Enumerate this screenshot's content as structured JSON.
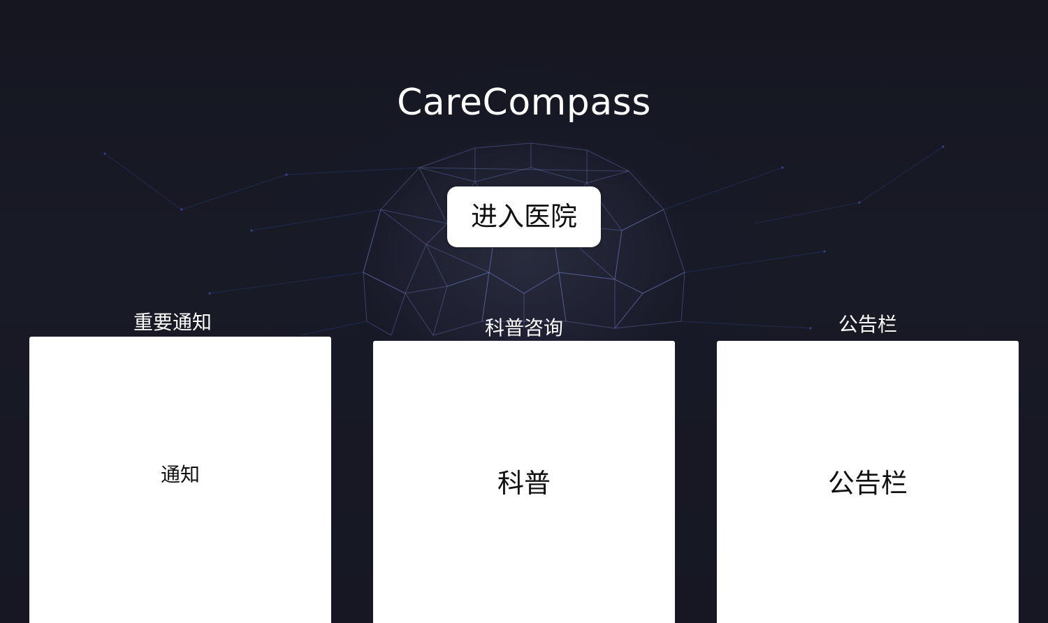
{
  "app": {
    "title": "CareCompass"
  },
  "actions": {
    "enter_hospital_label": "进入医院"
  },
  "panels": [
    {
      "heading": "重要通知",
      "body": "通知"
    },
    {
      "heading": "科普咨询",
      "body": "科普"
    },
    {
      "heading": "公告栏",
      "body": "公告栏"
    }
  ],
  "colors": {
    "background": "#14151f",
    "network_lines": "#3a4a9a",
    "panel": "#ffffff",
    "text_light": "#ffffff",
    "text_dark": "#111111"
  }
}
